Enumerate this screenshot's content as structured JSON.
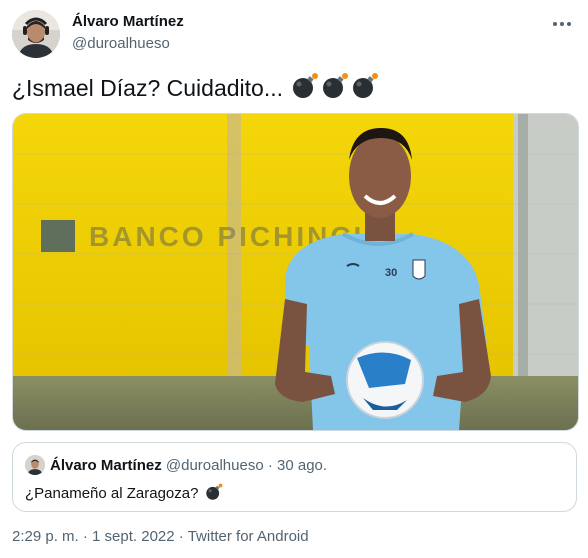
{
  "tweet": {
    "author_name": "Álvaro Martínez",
    "author_handle": "@duroalhueso",
    "text": "¿Ismael Díaz? Cuidadito...",
    "emoji_icons": [
      "bomb-icon",
      "bomb-icon",
      "bomb-icon"
    ]
  },
  "media": {
    "photo_text": "BANCO PICHINCHA",
    "jersey_number": "30"
  },
  "quoted_tweet": {
    "author_name": "Álvaro Martínez",
    "author_handle": "@duroalhueso",
    "separator": "·",
    "date": "30 ago.",
    "text": "¿Panameño al Zaragoza?",
    "emoji_icon": "bomb-icon"
  },
  "footer": {
    "time": "2:29 p. m.",
    "separator1": "·",
    "date": "1 sept. 2022",
    "separator2": "·",
    "source": "Twitter for Android"
  },
  "colors": {
    "primary_text": "#0f1419",
    "secondary_text": "#536471",
    "border": "#cfd9de",
    "wall_yellow": "#f2d400",
    "jersey_blue": "#7fc3e8"
  }
}
